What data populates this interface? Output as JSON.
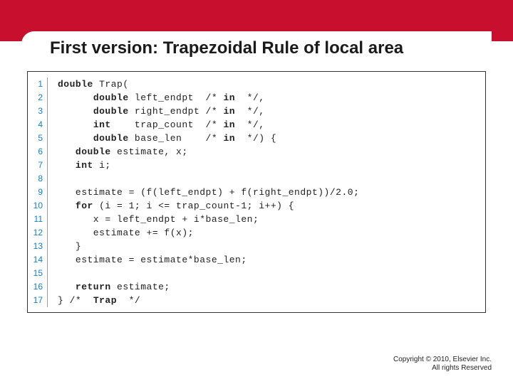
{
  "title": "First version: Trapezoidal Rule of local area",
  "code": {
    "lines": [
      {
        "n": "1",
        "tokens": [
          {
            "t": "double",
            "k": true
          },
          {
            "t": " Trap(",
            "k": false
          }
        ]
      },
      {
        "n": "2",
        "tokens": [
          {
            "t": "      ",
            "k": false
          },
          {
            "t": "double",
            "k": true
          },
          {
            "t": " left_endpt  /* ",
            "k": false
          },
          {
            "t": "in",
            "k": true
          },
          {
            "t": "  */,",
            "k": false
          }
        ]
      },
      {
        "n": "3",
        "tokens": [
          {
            "t": "      ",
            "k": false
          },
          {
            "t": "double",
            "k": true
          },
          {
            "t": " right_endpt /* ",
            "k": false
          },
          {
            "t": "in",
            "k": true
          },
          {
            "t": "  */,",
            "k": false
          }
        ]
      },
      {
        "n": "4",
        "tokens": [
          {
            "t": "      ",
            "k": false
          },
          {
            "t": "int",
            "k": true
          },
          {
            "t": "    trap_count  /* ",
            "k": false
          },
          {
            "t": "in",
            "k": true
          },
          {
            "t": "  */,",
            "k": false
          }
        ]
      },
      {
        "n": "5",
        "tokens": [
          {
            "t": "      ",
            "k": false
          },
          {
            "t": "double",
            "k": true
          },
          {
            "t": " base_len    /* ",
            "k": false
          },
          {
            "t": "in",
            "k": true
          },
          {
            "t": "  */) {",
            "k": false
          }
        ]
      },
      {
        "n": "6",
        "tokens": [
          {
            "t": "   ",
            "k": false
          },
          {
            "t": "double",
            "k": true
          },
          {
            "t": " estimate, x;",
            "k": false
          }
        ]
      },
      {
        "n": "7",
        "tokens": [
          {
            "t": "   ",
            "k": false
          },
          {
            "t": "int",
            "k": true
          },
          {
            "t": " i;",
            "k": false
          }
        ]
      },
      {
        "n": "8",
        "tokens": [
          {
            "t": "",
            "k": false
          }
        ]
      },
      {
        "n": "9",
        "tokens": [
          {
            "t": "   estimate = (f(left_endpt) + f(right_endpt))/2.0;",
            "k": false
          }
        ]
      },
      {
        "n": "10",
        "tokens": [
          {
            "t": "   ",
            "k": false
          },
          {
            "t": "for",
            "k": true
          },
          {
            "t": " (i = 1; i <= trap_count-1; i++) {",
            "k": false
          }
        ]
      },
      {
        "n": "11",
        "tokens": [
          {
            "t": "      x = left_endpt + i*base_len;",
            "k": false
          }
        ]
      },
      {
        "n": "12",
        "tokens": [
          {
            "t": "      estimate += f(x);",
            "k": false
          }
        ]
      },
      {
        "n": "13",
        "tokens": [
          {
            "t": "   }",
            "k": false
          }
        ]
      },
      {
        "n": "14",
        "tokens": [
          {
            "t": "   estimate = estimate*base_len;",
            "k": false
          }
        ]
      },
      {
        "n": "15",
        "tokens": [
          {
            "t": "",
            "k": false
          }
        ]
      },
      {
        "n": "16",
        "tokens": [
          {
            "t": "   ",
            "k": false
          },
          {
            "t": "return",
            "k": true
          },
          {
            "t": " estimate;",
            "k": false
          }
        ]
      },
      {
        "n": "17",
        "tokens": [
          {
            "t": "} /*  ",
            "k": false
          },
          {
            "t": "Trap",
            "k": true
          },
          {
            "t": "  */",
            "k": false
          }
        ]
      }
    ]
  },
  "copyright": {
    "line1": "Copyright © 2010, Elsevier Inc.",
    "line2": "All rights Reserved"
  }
}
